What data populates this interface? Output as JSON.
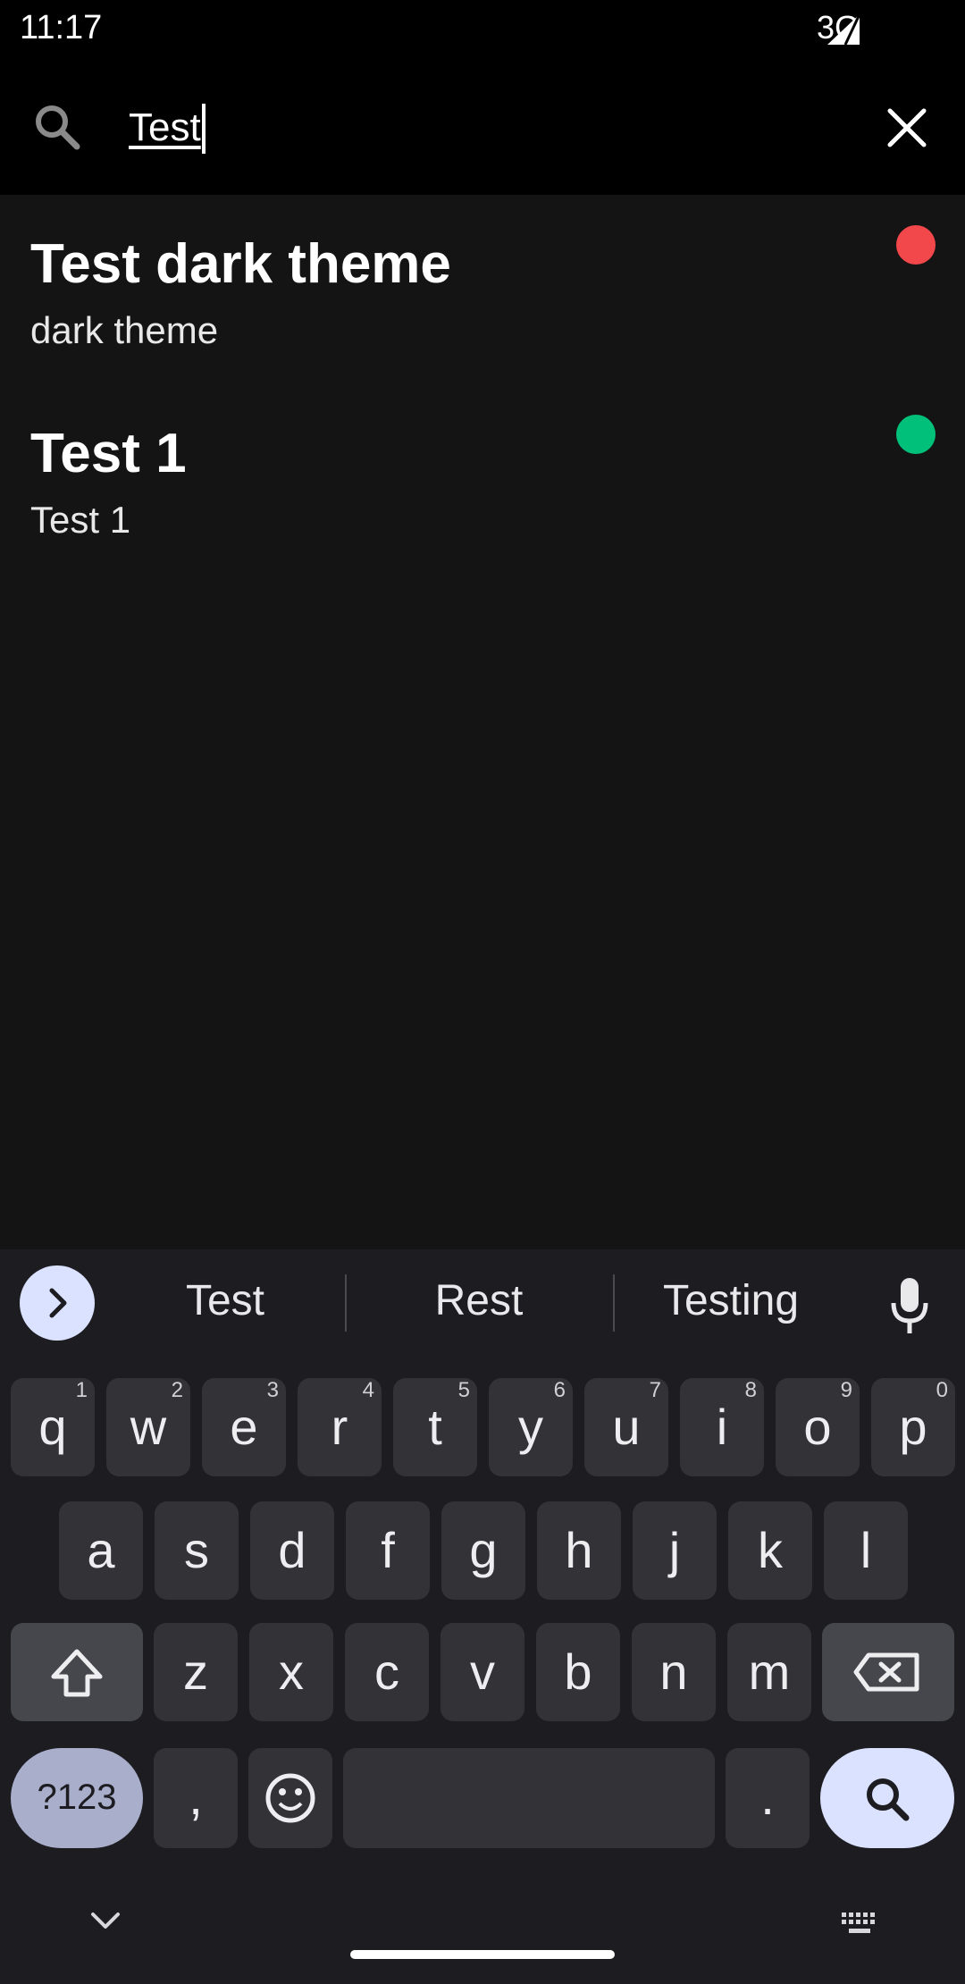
{
  "status_bar": {
    "time": "11:17",
    "network": "3G"
  },
  "search": {
    "query": "Test",
    "icon": "search-icon",
    "clear_icon": "close-icon"
  },
  "results": [
    {
      "title": "Test dark theme",
      "subtitle": "dark theme",
      "color": "#f2474b"
    },
    {
      "title": "Test 1",
      "subtitle": "Test 1",
      "color": "#00c07a"
    }
  ],
  "keyboard": {
    "suggestions": [
      "Test",
      "Rest",
      "Testing"
    ],
    "row1": [
      {
        "k": "q",
        "n": "1"
      },
      {
        "k": "w",
        "n": "2"
      },
      {
        "k": "e",
        "n": "3"
      },
      {
        "k": "r",
        "n": "4"
      },
      {
        "k": "t",
        "n": "5"
      },
      {
        "k": "y",
        "n": "6"
      },
      {
        "k": "u",
        "n": "7"
      },
      {
        "k": "i",
        "n": "8"
      },
      {
        "k": "o",
        "n": "9"
      },
      {
        "k": "p",
        "n": "0"
      }
    ],
    "row2": [
      "a",
      "s",
      "d",
      "f",
      "g",
      "h",
      "j",
      "k",
      "l"
    ],
    "row3": [
      "z",
      "x",
      "c",
      "v",
      "b",
      "n",
      "m"
    ],
    "symbols_label": "?123",
    "comma": ",",
    "period": ".",
    "accent": "#dbe2ff"
  }
}
